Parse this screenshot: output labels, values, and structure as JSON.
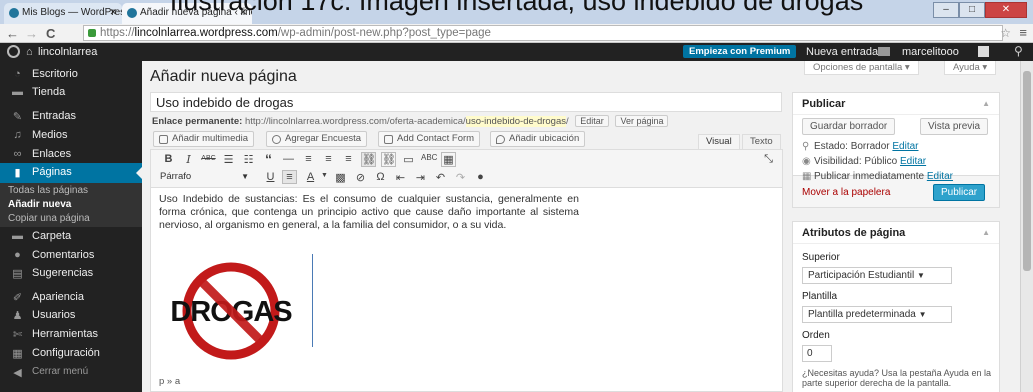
{
  "caption": "Ilustración 17c: Imagen insertada, uso indebido de drogas",
  "browser": {
    "tabs": [
      {
        "label": "Mis Blogs — WordPress.c"
      },
      {
        "label": "Añadir nueva página ‹ linc"
      }
    ],
    "url_scheme": "https://",
    "url_host": "lincolnlarrea.wordpress.com",
    "url_path": "/wp-admin/post-new.php?post_type=page"
  },
  "adminbar": {
    "site_name": "lincolnlarrea",
    "premium": "Empieza con Premium",
    "new_entry": "Nueva entrada",
    "user": "marcelitooo"
  },
  "sidebar": {
    "items": [
      {
        "label": "Escritorio",
        "icon": "dashboard-icon"
      },
      {
        "label": "Tienda",
        "icon": "store-icon"
      },
      {
        "label": "Entradas",
        "icon": "pin-icon"
      },
      {
        "label": "Medios",
        "icon": "media-icon"
      },
      {
        "label": "Enlaces",
        "icon": "link-icon"
      },
      {
        "label": "Páginas",
        "icon": "pages-icon"
      },
      {
        "label": "Carpeta",
        "icon": "folder-icon"
      },
      {
        "label": "Comentarios",
        "icon": "comment-icon"
      },
      {
        "label": "Sugerencias",
        "icon": "suggestions-icon"
      },
      {
        "label": "Apariencia",
        "icon": "appearance-icon"
      },
      {
        "label": "Usuarios",
        "icon": "users-icon"
      },
      {
        "label": "Herramientas",
        "icon": "tools-icon"
      },
      {
        "label": "Configuración",
        "icon": "settings-icon"
      },
      {
        "label": "Cerrar menú",
        "icon": "collapse-icon"
      }
    ],
    "sub": [
      "Todas las páginas",
      "Añadir nueva",
      "Copiar una página"
    ]
  },
  "main": {
    "screen_options": "Opciones de pantalla ▾",
    "help": "Ayuda ▾",
    "page_title": "Añadir nueva página",
    "post_title": "Uso indebido de drogas",
    "permalink_label": "Enlace permanente:",
    "permalink_base": "http://lincolnlarrea.wordpress.com/oferta-academica/",
    "permalink_slug": "uso-indebido-de-drogas",
    "permalink_end": "/",
    "edit_btn": "Editar",
    "view_btn": "Ver página",
    "media_buttons": [
      "Añadir multimedia",
      "Agregar Encuesta",
      "Add Contact Form",
      "Añadir ubicación"
    ],
    "tab_visual": "Visual",
    "tab_text": "Texto",
    "format_select": "Párrafo",
    "content": "Uso Indebido de sustancias: Es el consumo de cualquier sustancia, generalmente en forma crónica, que contenga un principio activo que cause daño importante al sistema nervioso, al organismo en general, a la familia del consumidor, o a su vida.",
    "image_text": "DROGAS",
    "path": "p » a"
  },
  "publish": {
    "title": "Publicar",
    "save_draft": "Guardar borrador",
    "preview": "Vista previa",
    "status_label": "Estado: Borrador",
    "visibility_label": "Visibilidad: Público",
    "publish_label": "Publicar inmediatamente",
    "edit": "Editar",
    "trash": "Mover a la papelera",
    "publish_btn": "Publicar"
  },
  "attributes": {
    "title": "Atributos de página",
    "parent_label": "Superior",
    "parent_value": "Participación Estudiantil",
    "template_label": "Plantilla",
    "template_value": "Plantilla predeterminada",
    "order_label": "Orden",
    "order_value": "0",
    "help_text": "¿Necesitas ayuda? Usa la pestaña Ayuda en la parte superior derecha de la pantalla."
  },
  "colors": {
    "accent": "#0074a2",
    "sidebar": "#222222",
    "premium": "#0074a2",
    "publish": "#2ea2cc"
  }
}
